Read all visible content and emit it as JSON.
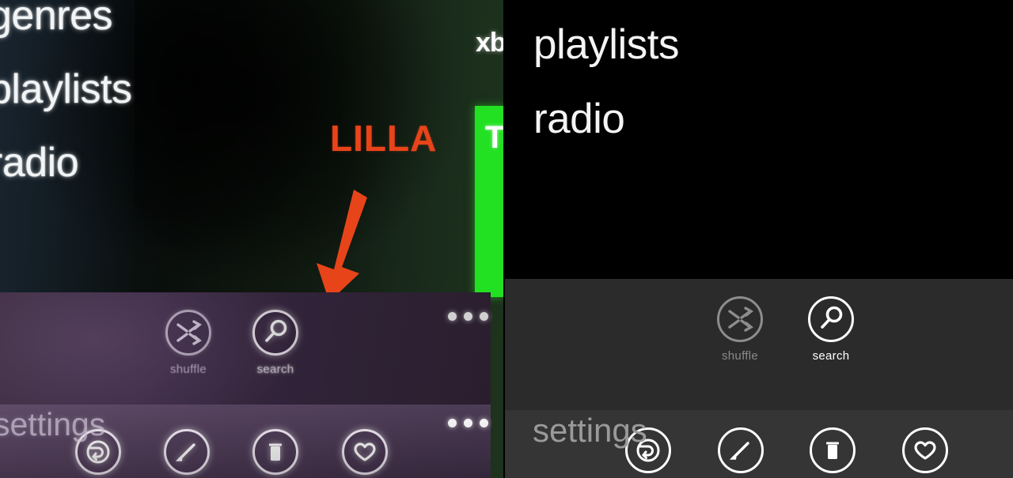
{
  "meta": {
    "description": "Windows Phone music app screenshot comparison: photographed phone screen (left) beside a clean UI render (right)"
  },
  "left_panel": {
    "nav_items": [
      {
        "label": "genres"
      },
      {
        "label": "playlists"
      },
      {
        "label": "radio"
      }
    ],
    "xbox_label": "xb",
    "green_tile_text": "T",
    "annotation": {
      "label": "LILLA",
      "color": "#e8441a",
      "arrow": "down-arrow"
    },
    "appbar": {
      "buttons": [
        {
          "name": "shuffle",
          "label": "shuffle",
          "icon": "shuffle-icon",
          "state": "dimmed"
        },
        {
          "name": "search",
          "label": "search",
          "icon": "search-icon",
          "state": "active"
        }
      ],
      "overflow": "..."
    },
    "appbar_secondary": {
      "settings_label": "settings",
      "buttons": [
        {
          "name": "share",
          "icon": "share-icon"
        },
        {
          "name": "edit",
          "icon": "pencil-icon"
        },
        {
          "name": "delete",
          "icon": "trash-icon"
        },
        {
          "name": "favorite",
          "icon": "heart-icon"
        }
      ],
      "overflow": "..."
    },
    "colors": {
      "appbar_background": "#402e49",
      "appbar_secondary_background": "#4e3a57"
    }
  },
  "right_panel": {
    "nav_items": [
      {
        "label": "playlists"
      },
      {
        "label": "radio"
      }
    ],
    "appbar": {
      "buttons": [
        {
          "name": "shuffle",
          "label": "shuffle",
          "icon": "shuffle-icon",
          "state": "dimmed"
        },
        {
          "name": "search",
          "label": "search",
          "icon": "search-icon",
          "state": "active"
        }
      ]
    },
    "appbar_secondary": {
      "settings_label": "settings",
      "buttons": [
        {
          "name": "share",
          "icon": "share-icon"
        },
        {
          "name": "edit",
          "icon": "pencil-icon"
        },
        {
          "name": "delete",
          "icon": "trash-icon"
        },
        {
          "name": "favorite",
          "icon": "heart-icon"
        }
      ]
    },
    "colors": {
      "background": "#000000",
      "appbar_background": "#2b2b2b",
      "appbar_secondary_background": "#353535"
    }
  }
}
